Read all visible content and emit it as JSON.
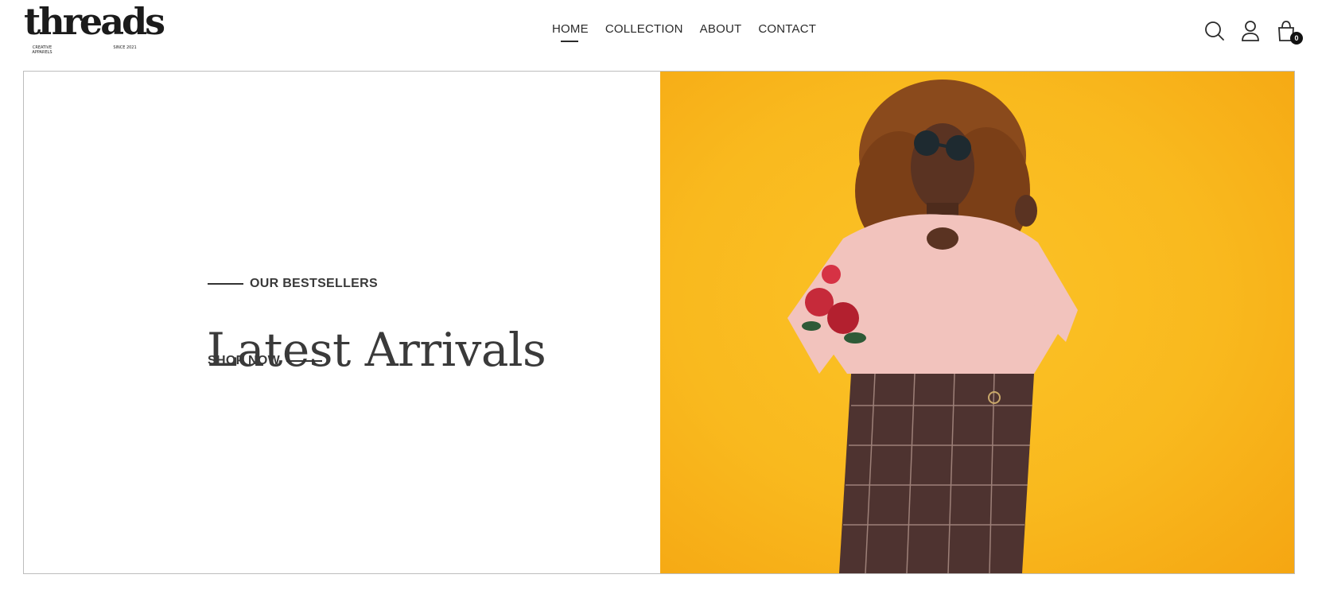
{
  "brand": {
    "name": "threads",
    "tagline_left": "CREATIVE APPARELS",
    "tagline_right": "SINCE 2021"
  },
  "nav": {
    "items": [
      {
        "label": "HOME",
        "active": true
      },
      {
        "label": "COLLECTION",
        "active": false
      },
      {
        "label": "ABOUT",
        "active": false
      },
      {
        "label": "CONTACT",
        "active": false
      }
    ]
  },
  "header_icons": {
    "search": "search-icon",
    "account": "user-icon",
    "cart": "shopping-bag-icon",
    "cart_count": "0"
  },
  "hero": {
    "eyebrow": "OUR BESTSELLERS",
    "headline": "Latest Arrivals",
    "cta": "SHOP NOW",
    "image_alt": "Woman in sunglasses wearing a pink floral sweater and plaid skirt against a yellow background",
    "background_color": "#f9b91e"
  }
}
